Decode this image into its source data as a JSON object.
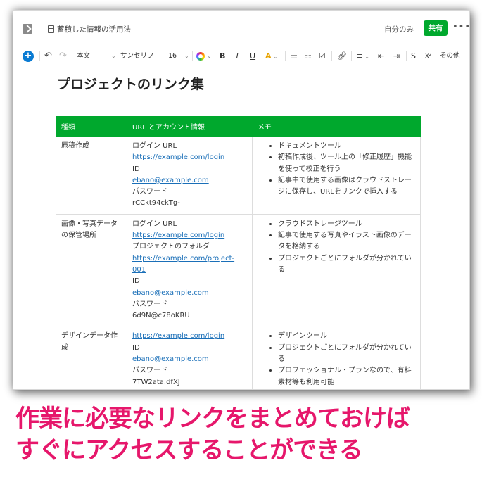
{
  "header": {
    "doc_title": "蓄積した情報の活用法",
    "visibility": "自分のみ",
    "share_label": "共有",
    "more_label": "•••"
  },
  "toolbar": {
    "add": "+",
    "undo": "↶",
    "redo": "↷",
    "style": "本文",
    "font": "サンセリフ",
    "size": "16",
    "bold": "B",
    "italic": "I",
    "underline": "U",
    "highlight": "A",
    "superscript": "x²",
    "other": "その他"
  },
  "page": {
    "title": "プロジェクトのリンク集"
  },
  "table": {
    "headers": [
      "種類",
      "URL とアカウント情報",
      "メモ"
    ],
    "rows": [
      {
        "type": "原稿作成",
        "info": [
          "ログイン URL",
          "https://example.com/login",
          "ID",
          "ebano@example.com",
          "パスワード",
          "rCCkt94ckTg-"
        ],
        "memo": [
          "ドキュメントツール",
          "初稿作成後、ツール上の「修正履歴」機能を使って校正を行う",
          "記事中で使用する画像はクラウドストレージに保存し、URLをリンクで挿入する"
        ]
      },
      {
        "type": "画像・写真データの保管場所",
        "info": [
          "ログイン URL",
          "https://example.com/login",
          "プロジェクトのフォルダ",
          "https://example.com/project-001",
          "ID",
          "ebano@example.com",
          "パスワード",
          "6d9N@c78oKRU"
        ],
        "memo": [
          "クラウドストレージツール",
          "記事で使用する写真やイラスト画像のデータを格納する",
          "プロジェクトごとにフォルダが分かれている"
        ]
      },
      {
        "type": "デザインデータ作成",
        "info": [
          "https://example.com/login",
          "ID",
          "ebano@example.com",
          "パスワード",
          "7TW2ata.dfXJ"
        ],
        "memo": [
          "デザインツール",
          "プロジェクトごとにフォルダが分かれている",
          "プロフェッショナル・プランなので、有料素材等も利用可能"
        ]
      }
    ]
  },
  "caption": {
    "line1": "作業に必要なリンクをまとめておけば",
    "line2": "すぐにアクセスすることができる"
  },
  "colors": {
    "accent_green": "#00a82d",
    "link_blue": "#1a6fb8",
    "caption_pink": "#e6176b"
  }
}
